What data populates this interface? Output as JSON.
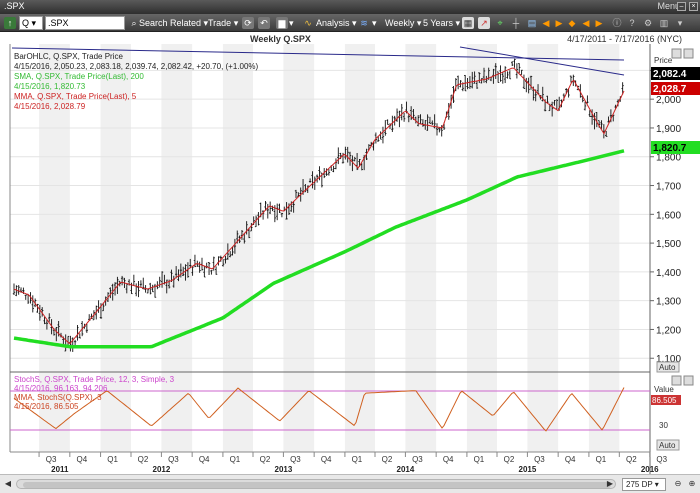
{
  "window": {
    "title": ".SPX",
    "menu_label": "Menu"
  },
  "toolbar": {
    "symbol_group": "Q",
    "symbol_value": ".SPX",
    "search_label": "Search",
    "related_label": "Related",
    "trade_label": "Trade",
    "analysis_label": "Analysis",
    "frequency_label": "Weekly",
    "range_label": "5 Years"
  },
  "chart": {
    "title": "Weekly Q.SPX",
    "date_range": "4/17/2011 - 7/17/2016 (NYC)"
  },
  "legend": {
    "ohlc_name": "BarOHLC, Q.SPX, Trade Price",
    "ohlc_values": "4/15/2016, 2,050.23, 2,083.18, 2,039.74, 2,082.42, +20.70, (+1.00%)",
    "sma_name": "SMA, Q.SPX, Trade Price(Last), 200",
    "sma_values": "4/15/2016, 1,820.73",
    "mma_name": "MMA, Q.SPX, Trade Price(Last), 5",
    "mma_values": "4/15/2016, 2,028.79"
  },
  "stoch_legend": {
    "stoch_name": "StochS, Q.SPX, Trade Price, 12, 3, Simple, 3",
    "stoch_values": "4/15/2016, 96.163, 94.206",
    "mma_name": "MMA, StochS(Q.SPX), 3",
    "mma_values": "4/15/2016, 86.505"
  },
  "price_axis": {
    "header": "Price",
    "auto_label": "Auto",
    "ticks": [
      "2,100",
      "2,000",
      "1,900",
      "1,800",
      "1,700",
      "1,600",
      "1,500",
      "1,400",
      "1,300",
      "1,200",
      "1,100"
    ],
    "last_price": "2,082.4",
    "mma_value": "2,028.7",
    "sma_value": "1,820.7"
  },
  "stoch_axis": {
    "header": "Value",
    "auto_label": "Auto",
    "current_value": "86.505",
    "tick": "30"
  },
  "time_axis": {
    "quarters": [
      "Q3",
      "Q4",
      "Q1",
      "Q2",
      "Q3",
      "Q4",
      "Q1",
      "Q2",
      "Q3",
      "Q4",
      "Q1",
      "Q2",
      "Q3",
      "Q4",
      "Q1",
      "Q2",
      "Q3",
      "Q4",
      "Q1",
      "Q2",
      "Q3"
    ],
    "years": [
      "2011",
      "2012",
      "2013",
      "2014",
      "2015",
      "2016"
    ]
  },
  "footer": {
    "period_label": "275 DP"
  },
  "colors": {
    "bars": "#111111",
    "sma": "#22dd22",
    "mma": "#cc2222",
    "stoch": "#d06020",
    "stoch_bands": "#cc66cc",
    "trendline": "#2a2a8a",
    "band_shade": "#f0f0f0"
  },
  "chart_data": {
    "type": "line",
    "title": "Weekly Q.SPX",
    "ylim": [
      1080,
      2150
    ],
    "series": [
      {
        "name": "MMA, Q.SPX, Trade Price(Last), 5",
        "x": [
          "2011-04-17",
          "2011-06-01",
          "2011-08-15",
          "2011-10-01",
          "2011-12-01",
          "2012-03-01",
          "2012-05-20",
          "2012-08-01",
          "2012-10-15",
          "2012-12-01",
          "2013-02-01",
          "2013-05-20",
          "2013-07-01",
          "2013-09-01",
          "2013-12-31",
          "2014-02-10",
          "2014-04-01",
          "2014-07-01",
          "2014-08-10",
          "2014-10-20",
          "2014-12-01",
          "2015-03-01",
          "2015-05-20",
          "2015-08-25",
          "2015-10-01",
          "2015-11-15",
          "2016-01-25",
          "2016-02-15",
          "2016-04-15"
        ],
        "values": [
          1340,
          1320,
          1200,
          1150,
          1235,
          1365,
          1340,
          1370,
          1430,
          1410,
          1490,
          1630,
          1610,
          1680,
          1810,
          1760,
          1860,
          1960,
          1915,
          1900,
          2050,
          2070,
          2110,
          1990,
          1960,
          2070,
          1920,
          1880,
          2028.79
        ]
      },
      {
        "name": "SMA, Q.SPX, Trade Price(Last), 200",
        "x": [
          "2011-04-17",
          "2011-10-01",
          "2012-06-01",
          "2013-01-01",
          "2013-06-01",
          "2014-01-01",
          "2014-06-01",
          "2015-01-01",
          "2015-06-01",
          "2016-01-01",
          "2016-04-15"
        ],
        "values": [
          1170,
          1140,
          1140,
          1240,
          1360,
          1470,
          1555,
          1650,
          1730,
          1790,
          1820.73
        ]
      },
      {
        "name": "StochS, Q.SPX, Trade Price, 12, 3, Simple, 3",
        "x": [
          "2011-04-17",
          "2011-08-20",
          "2011-10-15",
          "2012-01-20",
          "2012-06-01",
          "2012-09-20",
          "2012-11-20",
          "2013-02-15",
          "2013-06-20",
          "2013-09-15",
          "2014-01-31",
          "2014-03-01",
          "2014-08-01",
          "2014-10-20",
          "2014-12-15",
          "2015-03-20",
          "2015-05-20",
          "2015-08-25",
          "2015-11-10",
          "2016-02-10",
          "2016-04-15"
        ],
        "values": [
          75,
          15,
          45,
          90,
          20,
          85,
          35,
          95,
          30,
          90,
          20,
          85,
          90,
          15,
          90,
          40,
          88,
          10,
          85,
          12,
          96.163
        ]
      }
    ]
  }
}
